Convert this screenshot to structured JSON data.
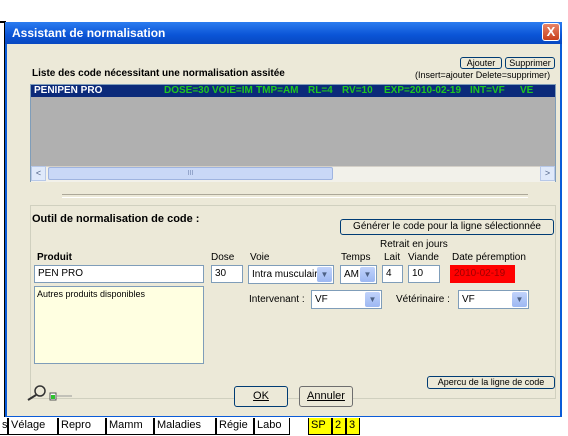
{
  "window": {
    "title": "Assistant de normalisation",
    "close_label": "X"
  },
  "list": {
    "heading": "Liste des code nécessitant une normalisation assitée",
    "add_label": "Ajouter",
    "delete_label": "Supprimer",
    "hint": "(Insert=ajouter Delete=supprimer)",
    "selected_row": {
      "product": "PENIPEN PRO",
      "dose": "DOSE=30",
      "voie": "VOIE=IM",
      "tmp": "TMP=AM",
      "rl": "RL=4",
      "rv": "RV=10",
      "exp": "EXP=2010-02-19",
      "int": "INT=VF",
      "ve": "VE"
    },
    "scroll_left": "<",
    "scroll_right": ">",
    "thumb_grip": "III"
  },
  "tool": {
    "heading": "Outil de normalisation de code :",
    "generate_label": "Générer le code pour la ligne sélectionnée",
    "retrait_label": "Retrait en jours",
    "produit_label": "Produit",
    "produit_value": "PEN PRO",
    "dose_label": "Dose",
    "dose_value": "30",
    "voie_label": "Voie",
    "voie_value": "Intra musculaire",
    "temps_label": "Temps",
    "temps_value": "AM",
    "lait_label": "Lait",
    "lait_value": "4",
    "viande_label": "Viande",
    "viande_value": "10",
    "date_label": "Date péremption",
    "date_value": "2010-02-19",
    "date_color": "#ff0000",
    "autres_label": "Autres produits disponibles",
    "intervenant_label": "Intervenant :",
    "intervenant_value": "VF",
    "veterinaire_label": "Vétérinaire :",
    "veterinaire_value": "VF"
  },
  "footer": {
    "apercu_label": "Apercu de la ligne de code",
    "ok_label": "OK",
    "annuler_label": "Annuler"
  },
  "tabs": [
    {
      "label": "s"
    },
    {
      "label": "Vélage"
    },
    {
      "label": "Repro"
    },
    {
      "label": "Mamm"
    },
    {
      "label": "Maladies"
    },
    {
      "label": "Régie"
    },
    {
      "label": "Labo"
    },
    {
      "label": "SP"
    },
    {
      "label": "2"
    },
    {
      "label": "3"
    }
  ],
  "colors": {
    "titlebar": "#0a54d6",
    "selection": "#0b2a7a",
    "row_green": "#1fc71f",
    "active_tab": "#ffff00"
  },
  "icons": [
    "magnifier-icon",
    "battery-icon",
    "chevron-down-icon",
    "close-icon"
  ]
}
